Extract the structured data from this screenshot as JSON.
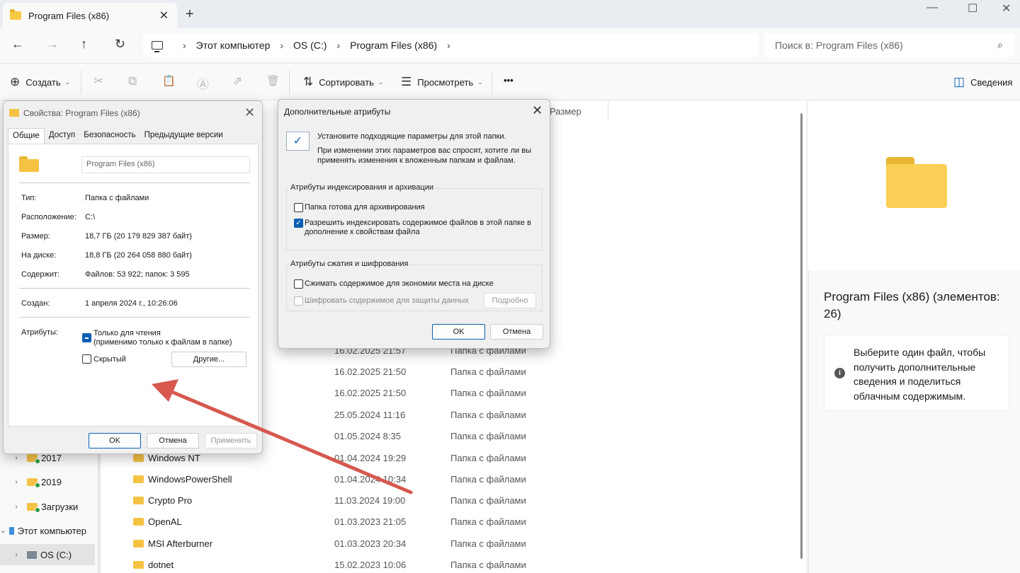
{
  "window": {
    "tab_title": "Program Files (x86)",
    "tab_close": "✕",
    "new_tab": "+",
    "controls": {
      "minimize": "—",
      "maximize": "☐",
      "close": "✕"
    }
  },
  "address": {
    "back": "←",
    "forward": "→",
    "up": "↑",
    "refresh": "↻",
    "separator": "›",
    "crumbs": [
      "Этот компьютер",
      "OS (C:)",
      "Program Files (x86)"
    ],
    "search_placeholder": "Поиск в: Program Files (x86)",
    "search_icon": "⌕"
  },
  "toolbar": {
    "create_label": "Создать",
    "sort_label": "Сортировать",
    "view_label": "Просмотреть",
    "more_label": "•••",
    "details_label": "Сведения",
    "icons": [
      "cut-icon",
      "copy-icon",
      "paste-icon",
      "rename-icon",
      "share-icon",
      "delete-icon"
    ],
    "glyphs": {
      "create": "⊕",
      "sort": "⇅",
      "view": "☰",
      "details": "◫",
      "chevron": "⌄",
      "cut": "✂",
      "copy": "⧉",
      "paste": "📋",
      "rename": "Ⓐ",
      "share": "⇗",
      "delete": "🗑"
    }
  },
  "nav_tree": {
    "items": [
      {
        "label": "2017",
        "chevron": "›",
        "type": "folder-sync"
      },
      {
        "label": "2019",
        "chevron": "›",
        "type": "folder-sync"
      },
      {
        "label": "Загрузки",
        "chevron": "›",
        "type": "folder-sync"
      },
      {
        "label": "Этот компьютер",
        "chevron": "⌄",
        "type": "pc"
      },
      {
        "label": "OS (C:)",
        "chevron": "›",
        "type": "drive",
        "selected": true
      }
    ]
  },
  "file_list": {
    "size_header": "Размер",
    "rows": [
      {
        "name": "",
        "date": "16.02.2025 21:57",
        "type": "Папка с файлами"
      },
      {
        "name": "",
        "date": "16.02.2025 21:50",
        "type": "Папка с файлами"
      },
      {
        "name": "",
        "date": "16.02.2025 21:50",
        "type": "Папка с файлами"
      },
      {
        "name": "",
        "date": "25.05.2024 11:16",
        "type": "Папка с файлами"
      },
      {
        "name": "",
        "date": "01.05.2024 8:35",
        "type": "Папка с файлами"
      },
      {
        "name": "Windows NT",
        "date": "01.04.2024 19:29",
        "type": "Папка с файлами"
      },
      {
        "name": "WindowsPowerShell",
        "date": "01.04.2024 10:34",
        "type": "Папка с файлами"
      },
      {
        "name": "Crypto Pro",
        "date": "11.03.2024 19:00",
        "type": "Папка с файлами"
      },
      {
        "name": "OpenAL",
        "date": "01.03.2023 21:05",
        "type": "Папка с файлами"
      },
      {
        "name": "MSI Afterburner",
        "date": "01.03.2023 20:34",
        "type": "Папка с файлами"
      },
      {
        "name": "dotnet",
        "date": "15.02.2023 10:06",
        "type": "Папка с файлами"
      }
    ]
  },
  "details_pane": {
    "title": "Program Files (x86) (элементов: 26)",
    "info_icon": "i",
    "info_text": "Выберите один файл, чтобы получить дополнительные сведения и поделиться облачным содержимым."
  },
  "properties_dialog": {
    "title": "Свойства: Program Files (x86)",
    "close": "✕",
    "tabs": [
      "Общие",
      "Доступ",
      "Безопасность",
      "Предыдущие версии"
    ],
    "folder_name": "Program Files (x86)",
    "fields": [
      {
        "label": "Тип:",
        "value": "Папка с файлами"
      },
      {
        "label": "Расположение:",
        "value": "C:\\"
      },
      {
        "label": "Размер:",
        "value": "18,7 ГБ (20 179 829 387 байт)"
      },
      {
        "label": "На диске:",
        "value": "18,8 ГБ (20 264 058 880 байт)"
      },
      {
        "label": "Содержит:",
        "value": "Файлов: 53 922; папок: 3 595"
      }
    ],
    "created_label": "Создан:",
    "created_value": "1 апреля 2024 г., 10:26:06",
    "attributes_label": "Атрибуты:",
    "readonly_line1": "Только для чтения",
    "readonly_line2": "(применимо только к файлам в папке)",
    "hidden_label": "Скрытый",
    "other_button": "Другие...",
    "ok": "OK",
    "cancel": "Отмена",
    "apply": "Применить"
  },
  "advanced_dialog": {
    "title": "Дополнительные атрибуты",
    "close": "✕",
    "check_icon": "✓",
    "intro_line1": "Установите подходящие параметры для этой папки.",
    "intro_line2": "При изменении этих параметров вас спросят, хотите ли вы",
    "intro_line3": "применять изменения к вложенным папкам и файлам.",
    "group1_label": "Атрибуты индексирования и архивации",
    "archive_label": "Папка готова для архивирования",
    "index_line1": "Разрешить индексировать содержимое файлов в этой папке в",
    "index_line2": "дополнение к свойствам файла",
    "group2_label": "Атрибуты сжатия и шифрования",
    "compress_label": "Сжимать содержимое для экономии места на диске",
    "encrypt_label": "Шифровать содержимое для защиты данных",
    "details_button": "Подробно",
    "ok": "OK",
    "cancel": "Отмена"
  },
  "colors": {
    "accent": "#0a5fb4",
    "folder": "#f5c243",
    "arrow": "#d6584f"
  }
}
